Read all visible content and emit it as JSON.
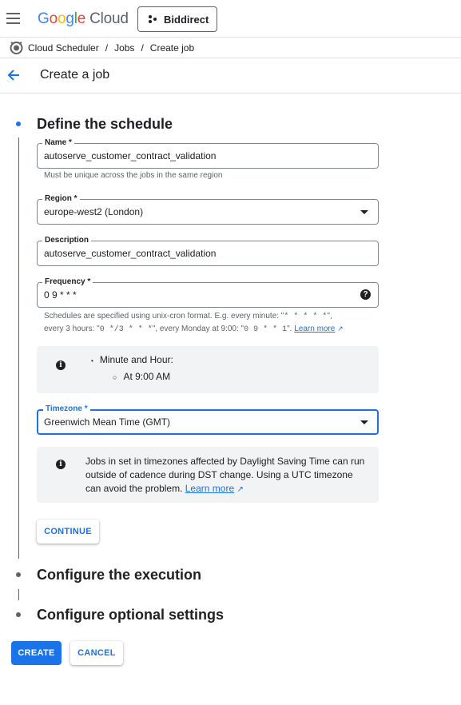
{
  "header": {
    "logo_google": [
      "G",
      "o",
      "o",
      "g",
      "l",
      "e"
    ],
    "logo_cloud": "Cloud",
    "project_name": "Biddirect"
  },
  "breadcrumb": {
    "items": [
      "Cloud Scheduler",
      "Jobs",
      "Create job"
    ],
    "separator": "/"
  },
  "page": {
    "title": "Create a job"
  },
  "steps": [
    {
      "title": "Define the schedule",
      "active": true
    },
    {
      "title": "Configure the execution",
      "active": false
    },
    {
      "title": "Configure optional settings",
      "active": false
    }
  ],
  "form": {
    "name": {
      "label": "Name *",
      "value": "autoserve_customer_contract_validation",
      "hint": "Must be unique across the jobs in the same region"
    },
    "region": {
      "label": "Region *",
      "value": "europe-west2 (London)"
    },
    "description": {
      "label": "Description",
      "value": "autoserve_customer_contract_validation"
    },
    "frequency": {
      "label": "Frequency *",
      "value": "0 9 * * *",
      "hint_line1_a": "Schedules are specified using unix-cron format. E.g. every minute: \"",
      "hint_code1": "* * * * *",
      "hint_line1_b": "\",",
      "hint_line2_a": "every 3 hours: \"",
      "hint_code2": "0 */3 * * *",
      "hint_line2_b": "\", every Monday at 9:00: \"",
      "hint_code3": "0 9 * * 1",
      "hint_line2_c": "\".",
      "learn_more": "Learn more"
    },
    "frequency_summary": {
      "item": "Minute and Hour:",
      "subitem": "At 9:00 AM"
    },
    "timezone": {
      "label": "Timezone *",
      "value": "Greenwich Mean Time (GMT)"
    },
    "timezone_info": {
      "text": "Jobs in set in timezones affected by Daylight Saving Time can run outside of cadence during DST change. Using a UTC timezone can avoid the problem.",
      "learn_more": "Learn more"
    },
    "continue_label": "CONTINUE"
  },
  "actions": {
    "create_label": "CREATE",
    "cancel_label": "CANCEL"
  },
  "colors": {
    "accent": "#1a73e8",
    "border": "#80868b",
    "info_bg": "#f1f3f4"
  }
}
